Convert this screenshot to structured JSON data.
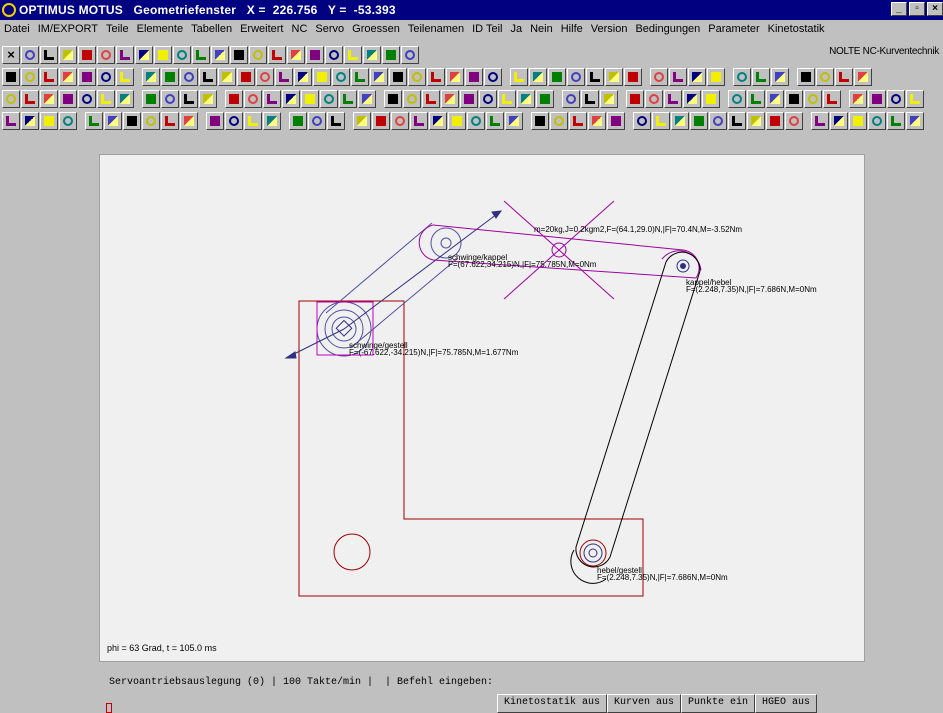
{
  "window": {
    "title": "OPTIMUS MOTUS   Geometriefenster   X =  226.756   Y =  -53.393",
    "min_glyph": "_",
    "max_glyph": "▫",
    "close_glyph": "×"
  },
  "menu": [
    "Datei",
    "IM/EXPORT",
    "Teile",
    "Elemente",
    "Tabellen",
    "Erweitert",
    "NC",
    "Servo",
    "Groessen",
    "Teilenamen",
    "ID Teil",
    "Ja",
    "Nein",
    "Hilfe",
    "Version",
    "Bedingungen",
    "Parameter",
    "Kinetostatik"
  ],
  "toolbar": {
    "brand": "NOLTE NC-Kurventechnik"
  },
  "drawing": {
    "annotations": {
      "schwinge_kappel_name": "schwinge/kappel",
      "schwinge_kappel_force": "F=(67.622,34.215)N,|F|=75.785N,M=0Nm",
      "mass_info": "m=20kg,J=0.2kgm2,F=(64.1,29.0)N,|F|=70.4N,M=-3.52Nm",
      "kappel_hebel_name": "kappel/hebel",
      "kappel_hebel_force": "F=(2.248,7.35)N,|F|=7.686N,M=0Nm",
      "schwinge_gestell_name": "schwinge/gestell",
      "schwinge_gestell_force": "F=(-67.622,-34.215)N,|F|=75.785N,M=1.677Nm",
      "hebel_gestell_name": "hebel/gestell",
      "hebel_gestell_force": "F=(2.248,7.35)N,|F|=7.686N,M=0Nm"
    },
    "phi": "phi = 63 Grad, t = 105.0 ms",
    "colors": {
      "frame": "#a00000",
      "coupler": "#a000a0",
      "vector": "#303080",
      "lever": "#000000"
    }
  },
  "status": {
    "line": "Servoantriebsauslegung (0) | 100 Takte/min |  | Befehl eingeben:"
  },
  "bottom_buttons": [
    "Kinetostatik aus",
    "Kurven aus",
    "Punkte ein",
    "HGEO aus"
  ]
}
